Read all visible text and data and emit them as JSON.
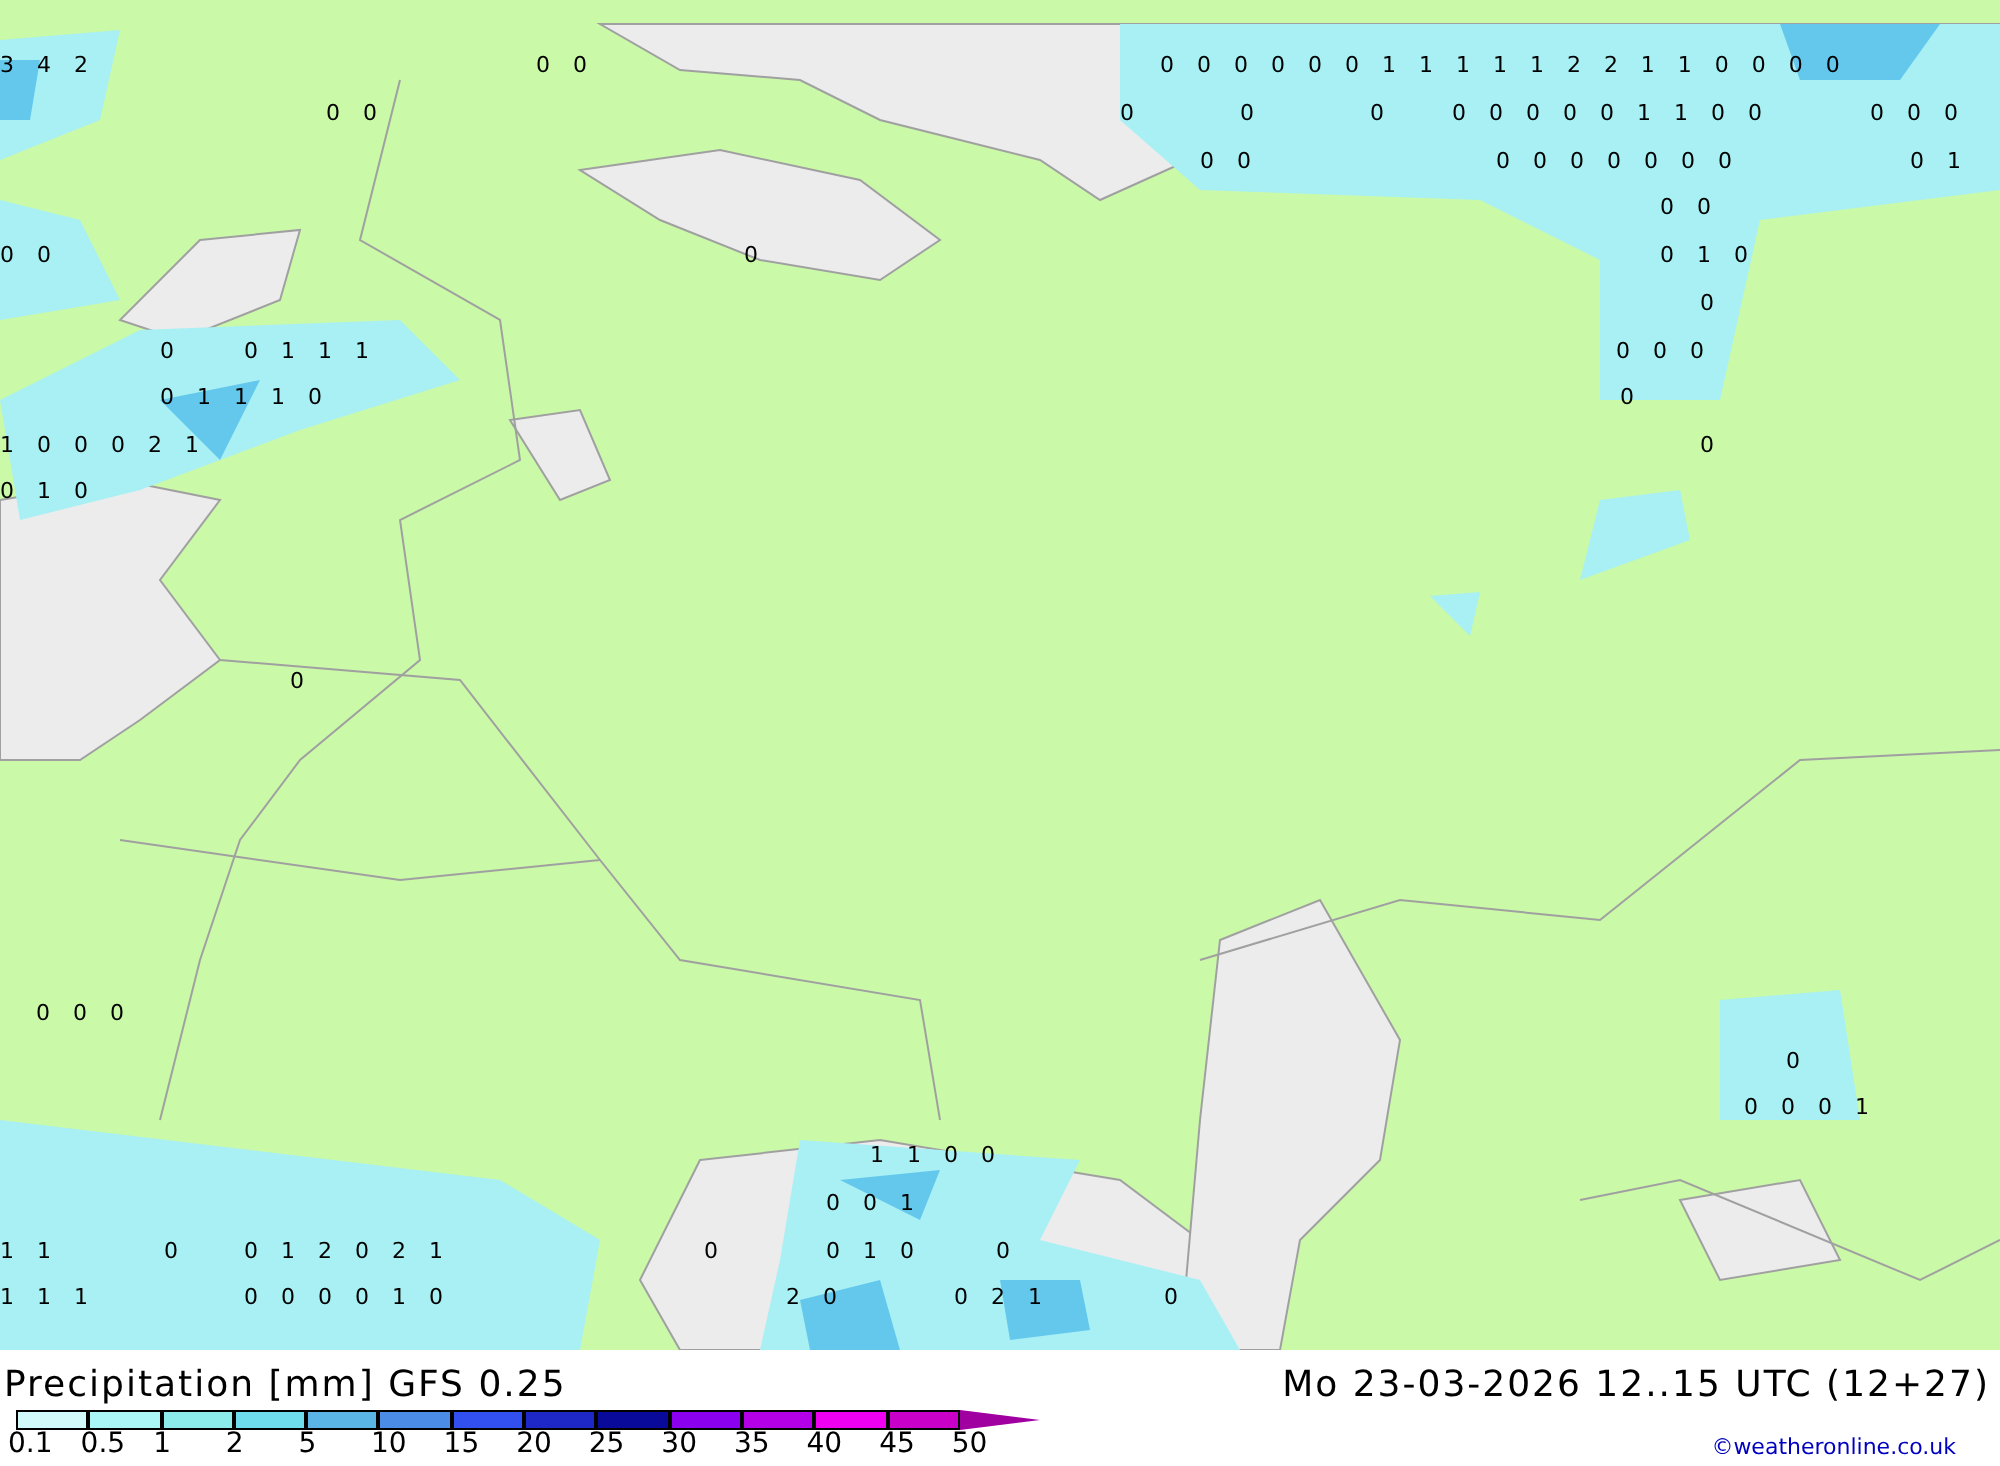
{
  "map": {
    "labels": [
      "3 4 2",
      "0 0",
      "0 0 0 0 0 0 1 1 1 1 1 2 2 1 1 0 0 0 0",
      "0 0",
      "0",
      "0",
      "0",
      "0 0 0 0 0 1 1 0 0",
      "0 0 0",
      "0 0",
      "0 0 0 0 0 0 0",
      "0 1",
      "0 0",
      "0",
      "0 0",
      "0 1 0",
      "0",
      "0",
      "0 1 1 1",
      "0 0 0",
      "0 1 1 1 0",
      "0",
      "1 0 0 0 2 1",
      "0",
      "0 1 0",
      "0",
      "0 0 0",
      "0",
      "0 0 0 1",
      "1 1 0 0",
      "0 0 1",
      "1 1",
      "0",
      "0 1 2 0 2 1",
      "0",
      "0 1 0",
      "0",
      "1 1 1",
      "0 0 0 0 1 0",
      "2 0",
      "0 2 1",
      "0"
    ]
  },
  "footer": {
    "title": "Precipitation [mm] GFS 0.25",
    "valid_time": "Mo 23-03-2026 12..15 UTC (12+27)",
    "credit": "©weatheronline.co.uk"
  },
  "legend": {
    "segments": [
      {
        "color": "#d2fafa",
        "kind": "swatch"
      },
      {
        "color": "#aaf5f5",
        "kind": "swatch"
      },
      {
        "color": "#8cebeb",
        "kind": "swatch"
      },
      {
        "color": "#6edcec",
        "kind": "swatch"
      },
      {
        "color": "#5ab4e6",
        "kind": "swatch"
      },
      {
        "color": "#4b8ce6",
        "kind": "swatch"
      },
      {
        "color": "#3250f0",
        "kind": "swatch"
      },
      {
        "color": "#1e28c8",
        "kind": "swatch"
      },
      {
        "color": "#0a0a9a",
        "kind": "swatch"
      },
      {
        "color": "#8c00f0",
        "kind": "swatch"
      },
      {
        "color": "#b400e6",
        "kind": "swatch"
      },
      {
        "color": "#f000f0",
        "kind": "swatch"
      },
      {
        "color": "#c800c8",
        "kind": "swatch"
      },
      {
        "color": "#a000a0",
        "kind": "arrow"
      }
    ],
    "labels": [
      "0.1",
      "0.5",
      "1",
      "2",
      "5",
      "10",
      "15",
      "20",
      "25",
      "30",
      "35",
      "40",
      "45",
      "50"
    ]
  }
}
